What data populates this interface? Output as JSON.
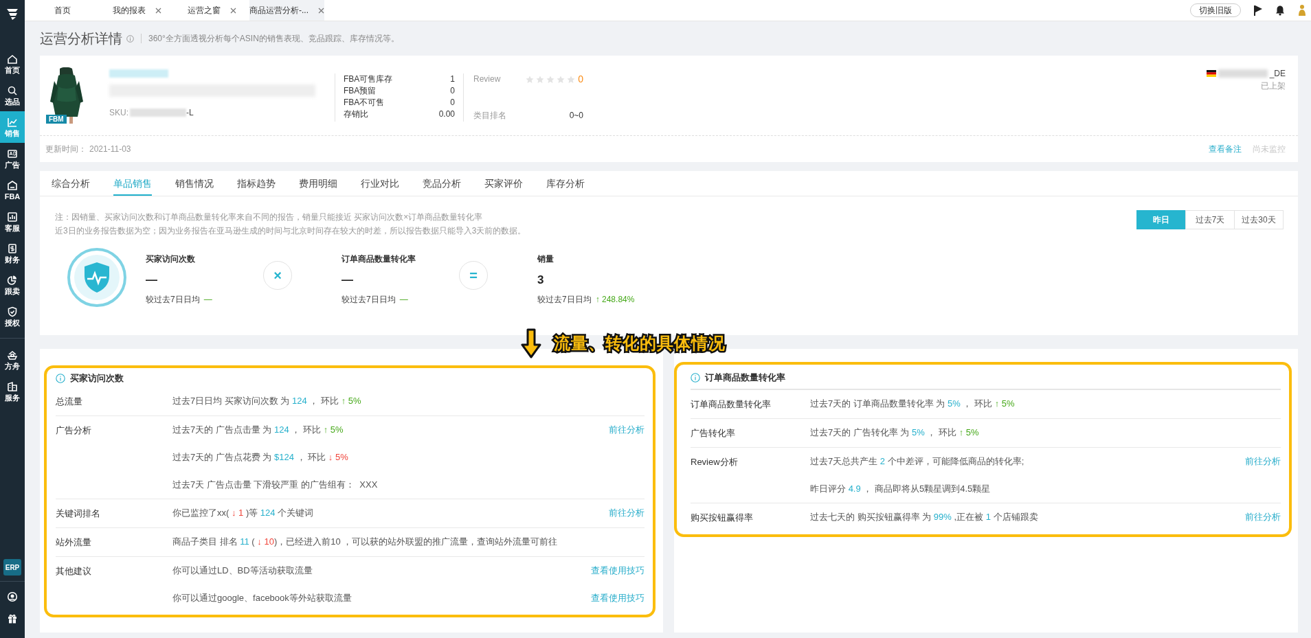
{
  "tab_bar": {
    "tabs": [
      {
        "label": "首页",
        "closable": false,
        "selected": false
      },
      {
        "label": "我的报表",
        "closable": true,
        "selected": false
      },
      {
        "label": "运营之窗",
        "closable": true,
        "selected": false
      },
      {
        "label": "商品运营分析-...",
        "closable": true,
        "selected": true
      }
    ],
    "switch_button": "切换旧版"
  },
  "sidebar": {
    "items": [
      {
        "label": "首页",
        "selected": false
      },
      {
        "label": "选品",
        "selected": false
      },
      {
        "label": "销售",
        "selected": true
      },
      {
        "label": "广告",
        "selected": false
      },
      {
        "label": "FBA",
        "selected": false
      },
      {
        "label": "客服",
        "selected": false
      },
      {
        "label": "财务",
        "selected": false
      },
      {
        "label": "跟卖",
        "selected": false
      },
      {
        "label": "授权",
        "selected": false
      },
      {
        "label": "方舟",
        "selected": false
      },
      {
        "label": "服务",
        "selected": false
      }
    ],
    "badge": "ERP"
  },
  "header": {
    "title": "运营分析详情",
    "subtitle": "360°全方面透视分析每个ASIN的销售表现、竞品跟踪、库存情况等。"
  },
  "product": {
    "badge": "FBM",
    "sku_label": "SKU:",
    "sku_suffix": "-L",
    "stock": [
      {
        "label": "FBA可售库存",
        "value": "1"
      },
      {
        "label": "FBA预留",
        "value": "0"
      },
      {
        "label": "FBA不可售",
        "value": "0"
      },
      {
        "label": "存销比",
        "value": "0.00"
      }
    ],
    "review": {
      "label": "Review",
      "stars": 0,
      "count": "0"
    },
    "rank": {
      "label": "类目排名",
      "value": "0~0"
    },
    "store_suffix": "_DE",
    "status": "已上架",
    "updated_label": "更新时间：",
    "updated": "2021-11-03",
    "links": [
      {
        "label": "查看备注",
        "disabled": false
      },
      {
        "label": "尚未监控",
        "disabled": true
      }
    ]
  },
  "analysis_tabs": [
    {
      "label": "综合分析",
      "selected": false
    },
    {
      "label": "单品销售",
      "selected": true
    },
    {
      "label": "销售情况",
      "selected": false
    },
    {
      "label": "指标趋势",
      "selected": false
    },
    {
      "label": "费用明细",
      "selected": false
    },
    {
      "label": "行业对比",
      "selected": false
    },
    {
      "label": "竞品分析",
      "selected": false
    },
    {
      "label": "买家评价",
      "selected": false
    },
    {
      "label": "库存分析",
      "selected": false
    }
  ],
  "notes": [
    "注：因销量、买家访问次数和订单商品数量转化率来自不同的报告，销量只能接近 买家访问次数×订单商品数量转化率",
    "近3日的业务报告数据为空；因为业务报告在亚马逊生成的时间与北京时间存在较大的时差，所以报告数据只能导入3天前的数据。"
  ],
  "periods": [
    {
      "label": "昨日",
      "selected": true
    },
    {
      "label": "过去7天",
      "selected": false
    },
    {
      "label": "过去30天",
      "selected": false
    }
  ],
  "metrics": [
    {
      "label": "买家访问次数",
      "value": "—",
      "compare_label": "较过去7日日均",
      "change": "—"
    },
    {
      "label": "订单商品数量转化率",
      "value": "—",
      "compare_label": "较过去7日日均",
      "change": "—"
    },
    {
      "label": "销量",
      "value": "3",
      "compare_label": "较过去7日日均",
      "change": "↑ 248.84%"
    }
  ],
  "operators": [
    "×",
    "="
  ],
  "annotation": {
    "text": "流量、转化的具体情况"
  },
  "panels": [
    {
      "title": "买家访问次数",
      "header_divider": false,
      "rows": [
        {
          "label": "总流量",
          "lines": [
            {
              "segments": [
                {
                  "kind": "text",
                  "t": "过去7日日均 买家访问次数 为 "
                },
                {
                  "kind": "value",
                  "t": "124"
                },
                {
                  "kind": "text",
                  "t": " ， 环比 "
                },
                {
                  "kind": "up",
                  "t": "↑ 5%"
                }
              ]
            }
          ]
        },
        {
          "label": "广告分析",
          "lines": [
            {
              "segments": [
                {
                  "kind": "text",
                  "t": "过去7天的 广告点击量 为 "
                },
                {
                  "kind": "value",
                  "t": "124"
                },
                {
                  "kind": "text",
                  "t": " ， 环比 "
                },
                {
                  "kind": "up",
                  "t": "↑ 5%"
                }
              ],
              "link": "前往分析"
            },
            {
              "segments": [
                {
                  "kind": "text",
                  "t": "过去7天的 广告点花费 为 "
                },
                {
                  "kind": "value",
                  "t": "$124"
                },
                {
                  "kind": "text",
                  "t": " ， 环比 "
                },
                {
                  "kind": "down",
                  "t": "↓ 5%"
                }
              ]
            },
            {
              "segments": [
                {
                  "kind": "text",
                  "t": "过去7天 广告点击量 下滑较严重 的广告组有：  XXX"
                }
              ]
            }
          ]
        },
        {
          "label": "关键词排名",
          "lines": [
            {
              "segments": [
                {
                  "kind": "text",
                  "t": "你已监控了xx( "
                },
                {
                  "kind": "down",
                  "t": "↓ 1"
                },
                {
                  "kind": "text",
                  "t": " )等 "
                },
                {
                  "kind": "value",
                  "t": "124"
                },
                {
                  "kind": "text",
                  "t": " 个关键词"
                }
              ],
              "link": "前往分析"
            }
          ]
        },
        {
          "label": "站外流量",
          "lines": [
            {
              "segments": [
                {
                  "kind": "text",
                  "t": "商品子类目 排名 "
                },
                {
                  "kind": "value",
                  "t": "11"
                },
                {
                  "kind": "text",
                  "t": " ( "
                },
                {
                  "kind": "down",
                  "t": "↓ 10"
                },
                {
                  "kind": "text",
                  "t": ")，已经进入前10 ，可以获的站外联盟的推广流量，查询站外流量可前往"
                }
              ]
            }
          ]
        },
        {
          "label": "其他建议",
          "lines": [
            {
              "segments": [
                {
                  "kind": "text",
                  "t": "你可以通过LD、BD等活动获取流量"
                }
              ],
              "link": "查看使用技巧"
            },
            {
              "segments": [
                {
                  "kind": "text",
                  "t": "你可以通过google、facebook等外站获取流量"
                }
              ],
              "link": "查看使用技巧"
            }
          ]
        }
      ]
    },
    {
      "title": "订单商品数量转化率",
      "header_divider": true,
      "rows": [
        {
          "label": "订单商品数量转化率",
          "lines": [
            {
              "segments": [
                {
                  "kind": "text",
                  "t": "过去7天的 订单商品数量转化率 为 "
                },
                {
                  "kind": "value",
                  "t": "5%"
                },
                {
                  "kind": "text",
                  "t": " ， 环比 "
                },
                {
                  "kind": "up",
                  "t": "↑ 5%"
                }
              ]
            }
          ]
        },
        {
          "label": "广告转化率",
          "lines": [
            {
              "segments": [
                {
                  "kind": "text",
                  "t": "过去7天的 广告转化率 为 "
                },
                {
                  "kind": "value",
                  "t": "5%"
                },
                {
                  "kind": "text",
                  "t": " ， 环比 "
                },
                {
                  "kind": "up",
                  "t": "↑ 5%"
                }
              ]
            }
          ]
        },
        {
          "label": "Review分析",
          "lines": [
            {
              "segments": [
                {
                  "kind": "text",
                  "t": "过去7天总共产生 "
                },
                {
                  "kind": "value",
                  "t": "2"
                },
                {
                  "kind": "text",
                  "t": " 个中差评，可能降低商品的转化率;"
                }
              ],
              "link": "前往分析"
            },
            {
              "segments": [
                {
                  "kind": "text",
                  "t": "昨日评分 "
                },
                {
                  "kind": "value",
                  "t": "4.9"
                },
                {
                  "kind": "text",
                  "t": " ， 商品即将从5颗星调到4.5颗星"
                }
              ]
            }
          ]
        },
        {
          "label": "购买按钮赢得率",
          "lines": [
            {
              "segments": [
                {
                  "kind": "text",
                  "t": "过去七天的 购买按钮赢得率 为 "
                },
                {
                  "kind": "value",
                  "t": "99%"
                },
                {
                  "kind": "text",
                  "t": " ,正在被 "
                },
                {
                  "kind": "value",
                  "t": "1"
                },
                {
                  "kind": "text",
                  "t": " 个店铺跟卖"
                }
              ],
              "link": "前往分析"
            }
          ]
        }
      ]
    }
  ]
}
